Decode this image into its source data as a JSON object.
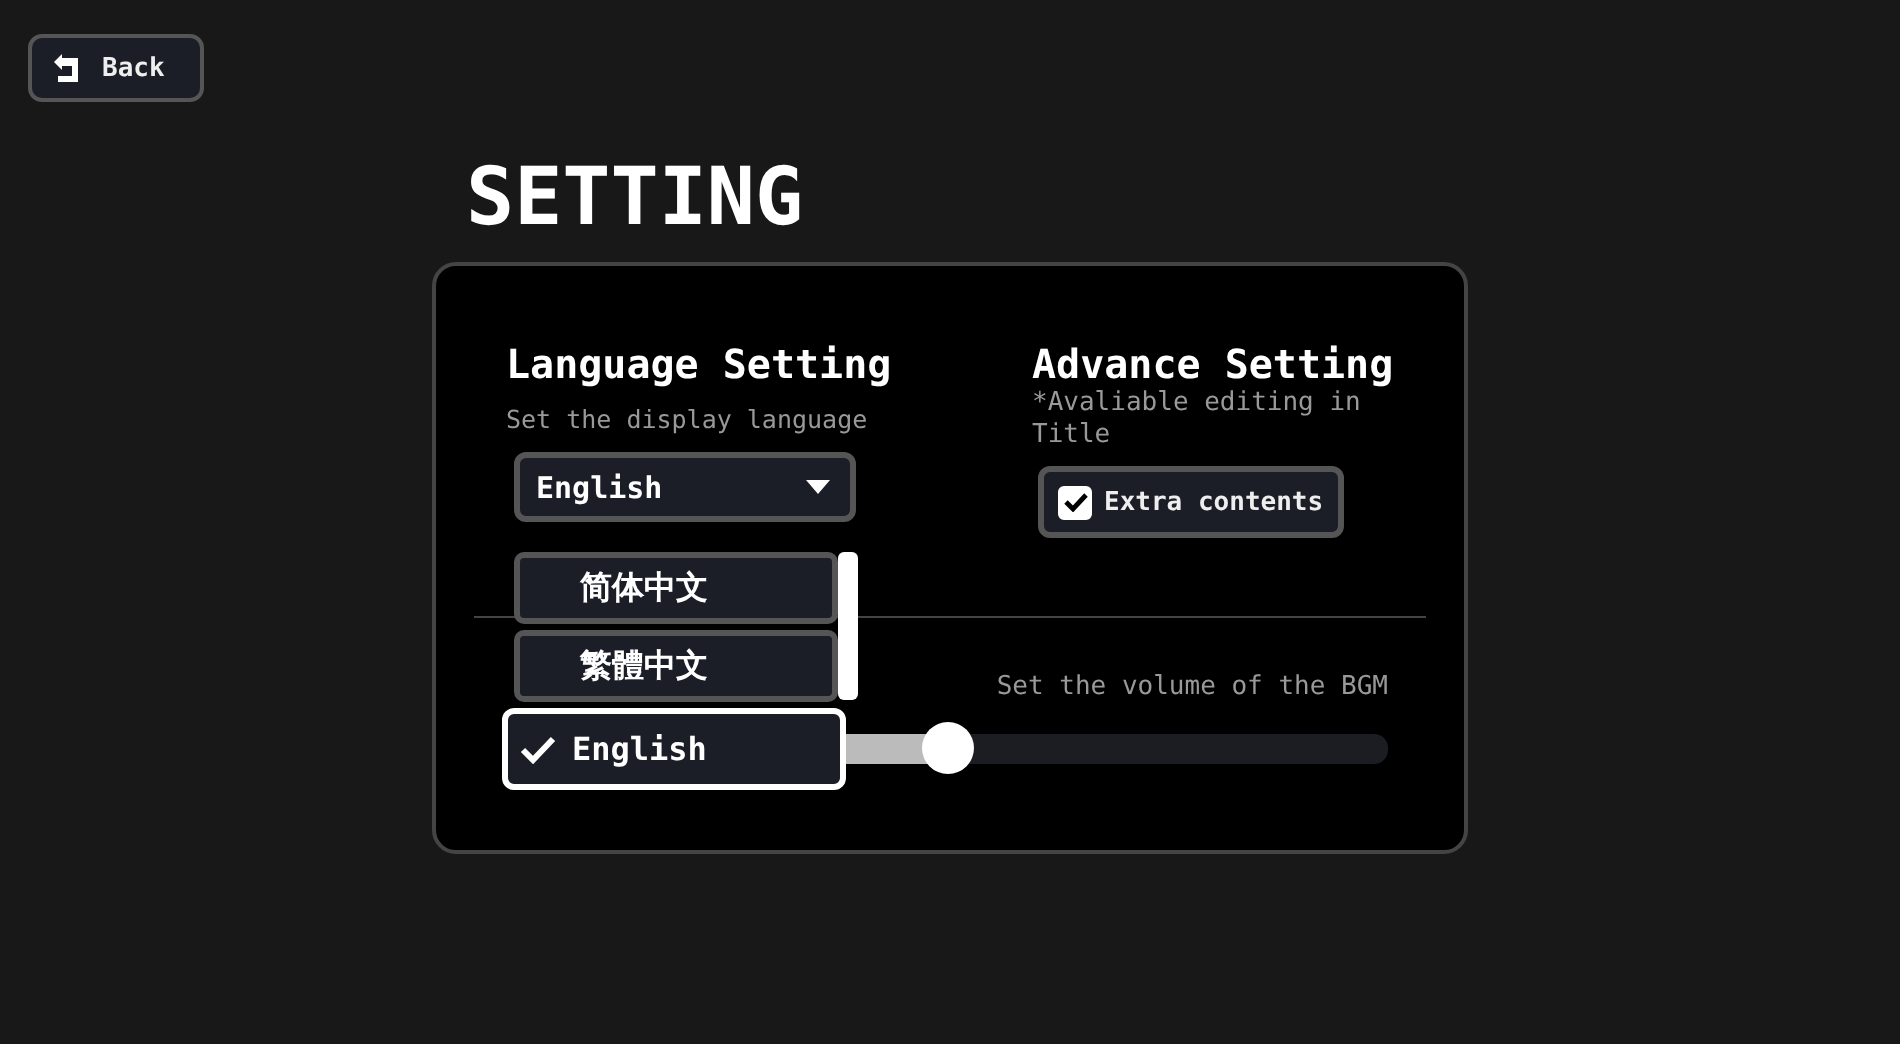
{
  "back_button": {
    "label": "Back"
  },
  "title": "SETTING",
  "language": {
    "title": "Language Setting",
    "subtitle": "Set the display language",
    "dropdown": {
      "value": "English",
      "expanded": true,
      "options": [
        {
          "label": "简体中文",
          "selected": false
        },
        {
          "label": "繁體中文",
          "selected": false
        },
        {
          "label": "English",
          "selected": true
        }
      ]
    }
  },
  "advance": {
    "title": "Advance Setting",
    "note": "*Avaliable editing in Title",
    "checkbox": {
      "label": "Extra contents",
      "checked": true
    }
  },
  "bgm": {
    "caption": "Set the volume of the BGM",
    "level": 0.5
  }
}
